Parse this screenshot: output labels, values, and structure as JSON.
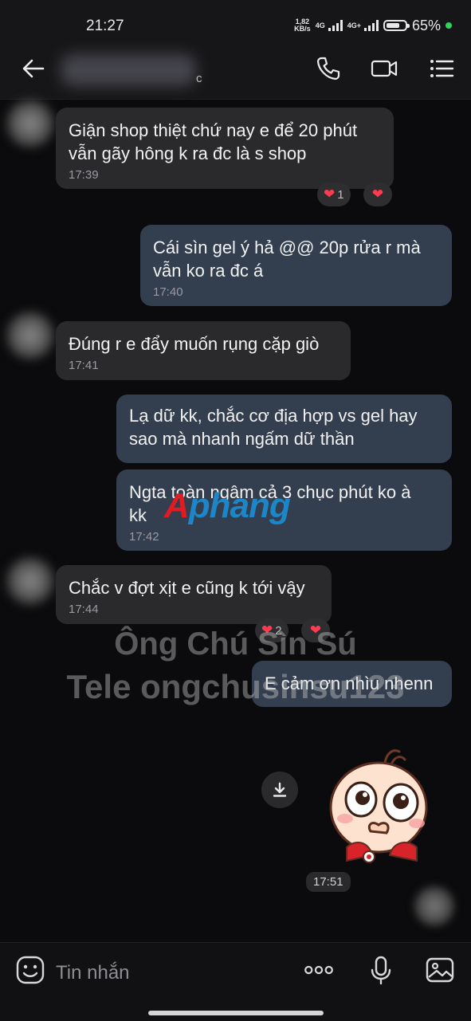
{
  "status": {
    "time": "21:27",
    "net_speed_value": "1,82",
    "net_speed_unit": "KB/s",
    "sim1_tag": "4G",
    "sim2_tag": "4G+",
    "battery": "65%"
  },
  "header": {
    "contact_suffix": "c"
  },
  "messages": [
    {
      "text": "Giận shop thiệt chứ nay e để 20 phút\nvẫn gãy hông k ra đc là s shop",
      "time": "17:39"
    },
    {
      "text": "Cái sìn gel ý hả @@ 20p rửa r mà\nvẫn ko ra đc á",
      "time": "17:40"
    },
    {
      "text": "Đúng r e đẩy muốn rụng cặp giò",
      "time": "17:41"
    },
    {
      "text": "Lạ dữ kk, chắc cơ địa hợp vs gel hay\nsao mà nhanh ngấm dữ thần",
      "time": ""
    },
    {
      "text": "Ngta toàn ngâm cả 3 chục phút ko à\nkk",
      "time": "17:42"
    },
    {
      "text": "Chắc v đợt xịt e cũng k tới vậy",
      "time": "17:44"
    },
    {
      "text": "E cảm ơn nhìu nhenn",
      "time": ""
    }
  ],
  "reactions": {
    "r1_count": "1",
    "r2_count": "2"
  },
  "sticker_time": "17:51",
  "watermarks": {
    "line1": "Ông Chú Sìn Sú",
    "line2": "Tele ongchusinsu123",
    "logo_part1": "A",
    "logo_part2": "phang"
  },
  "composer": {
    "placeholder": "Tin nhắn"
  },
  "colors": {
    "incoming_bubble": "#2a2a2d",
    "outgoing_bubble": "#333e4f",
    "heart": "#ff3b4f"
  }
}
